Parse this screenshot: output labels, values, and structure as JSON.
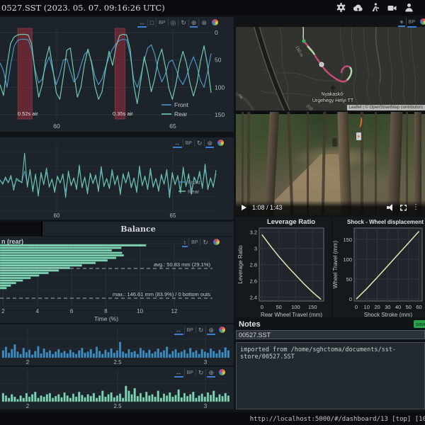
{
  "titlebar": {
    "title": "0527.SST (2023. 05. 07. 09:16:26 UTC)",
    "icons": [
      "settings",
      "cloud-upload",
      "rider-setup",
      "video-camera",
      "user"
    ]
  },
  "statusbar": {
    "url": "http://localhost:5000/#/dashboard/13 [top] [10"
  },
  "tabs": [
    {
      "label": "",
      "active": false
    },
    {
      "label": "Balance",
      "active": true
    }
  ],
  "toolbars": {
    "travel": {
      "tools": [
        "x-pan",
        "box-zoom",
        "bp",
        "wheel-zoom",
        "reset",
        "hover",
        "save",
        "logo"
      ],
      "active": [
        "x-pan",
        "hover"
      ]
    },
    "velocity": {
      "tools": [
        "x-pan",
        "bp",
        "reset",
        "hover",
        "logo"
      ],
      "active": [
        "x-pan",
        "hover"
      ]
    },
    "hist": {
      "tools": [
        "y-pan",
        "bp",
        "reset",
        "logo"
      ],
      "active": [
        "y-pan"
      ]
    },
    "vhist_front": {
      "tools": [
        "x-pan",
        "bp",
        "reset",
        "hover",
        "logo"
      ],
      "active": [
        "x-pan",
        "hover"
      ]
    },
    "vhist_rear": {
      "tools": [
        "x-pan",
        "bp",
        "reset",
        "hover",
        "logo"
      ],
      "active": [
        "x-pan",
        "hover"
      ]
    },
    "map": {
      "tools": [
        "pan",
        "bp",
        "logo"
      ],
      "active": [
        "pan",
        "bp"
      ]
    }
  },
  "charts": {
    "travel": {
      "type": "line",
      "y_ticks": [
        0,
        50,
        100,
        150
      ],
      "x_ticks": [
        60,
        65
      ],
      "legend": [
        "Front",
        "Rear"
      ],
      "air_bands": [
        {
          "label": "0.52s air",
          "from": 0.085,
          "to": 0.152
        },
        {
          "label": "0.35s air",
          "from": 0.545,
          "to": 0.592
        }
      ],
      "series": [
        {
          "name": "Front",
          "color": "#4d93c7",
          "values": [
            55,
            70,
            100,
            60,
            25,
            14,
            12,
            12,
            13,
            30,
            68,
            92,
            85,
            60,
            44,
            70,
            95,
            76,
            50,
            48,
            70,
            90,
            82,
            60,
            40,
            33,
            52,
            80,
            95,
            85,
            64,
            44,
            30,
            20,
            14,
            12,
            13,
            40,
            85,
            100,
            80,
            50,
            28,
            22,
            40,
            70,
            90,
            76,
            54,
            50,
            66,
            85,
            95,
            80,
            60,
            44,
            62,
            88,
            100,
            72,
            38
          ]
        },
        {
          "name": "Rear",
          "color": "#6fcbaa",
          "values": [
            95,
            115,
            60,
            20,
            8,
            4,
            3,
            3,
            4,
            20,
            75,
            118,
            95,
            50,
            25,
            65,
            110,
            122,
            80,
            32,
            28,
            75,
            118,
            100,
            58,
            30,
            55,
            98,
            122,
            108,
            68,
            34,
            60,
            25,
            5,
            3,
            4,
            30,
            95,
            130,
            88,
            44,
            72,
            108,
            84,
            48,
            30,
            62,
            102,
            122,
            94,
            58,
            34,
            56,
            92,
            116,
            92,
            52,
            24,
            60,
            110
          ]
        }
      ]
    },
    "velocity": {
      "type": "line",
      "x_ticks": [
        60,
        65
      ],
      "legend": [
        "Front",
        "Rear"
      ],
      "series": [
        {
          "name": "Front",
          "color": "#4d93c7",
          "values": [
            2,
            -5,
            8,
            -3,
            12,
            -18,
            4,
            0,
            -2,
            35,
            -10,
            35,
            -25,
            18,
            -40,
            22,
            -8,
            30,
            -15,
            5,
            -28,
            12,
            -4,
            18,
            -35,
            25,
            -10,
            8,
            -20,
            40,
            -15,
            10,
            -30,
            20,
            -5,
            15,
            -25,
            35,
            -12,
            6,
            -18,
            28,
            -8,
            14,
            -32,
            18,
            -4,
            22,
            -15,
            8,
            -26,
            36,
            -10,
            12,
            -20,
            30,
            -14,
            6,
            -24,
            16,
            -6,
            28,
            -38,
            20,
            -8,
            14,
            -28,
            34,
            -12,
            18,
            -30,
            10,
            -4,
            24,
            -16,
            40,
            -20,
            8,
            -14,
            26
          ]
        },
        {
          "name": "Rear",
          "color": "#6fcbaa",
          "values": [
            5,
            -10,
            15,
            -5,
            20,
            -30,
            10,
            3,
            -5,
            95,
            -20,
            40,
            -35,
            25,
            -50,
            30,
            -12,
            45,
            -20,
            8,
            -38,
            18,
            -6,
            25,
            -55,
            35,
            -15,
            12,
            -28,
            55,
            -22,
            15,
            -42,
            28,
            -8,
            22,
            -35,
            50,
            -18,
            10,
            -25,
            40,
            -12,
            20,
            -45,
            26,
            -6,
            32,
            -22,
            12,
            -38,
            52,
            -15,
            18,
            -28,
            44,
            -20,
            10,
            -34,
            24,
            -10,
            40,
            -55,
            30,
            -12,
            20,
            -40,
            48,
            -18,
            26,
            -44,
            15,
            -6,
            34,
            -24,
            58,
            -28,
            12,
            -20,
            38
          ]
        }
      ]
    },
    "travel_hist_rear": {
      "type": "bar-horizontal",
      "title_fragment": "n (rear)",
      "x_ticks": [
        2,
        4,
        6,
        8,
        10,
        12
      ],
      "xlabel": "Time (%)",
      "avg_label": "avg.: 50.83 mm (29.1%)",
      "max_label": "max.: 146.61 mm (83.9%) / 0 bottom outs",
      "bar_color": "#82d4b6",
      "values": [
        10.35,
        8.9,
        8.35,
        8.95,
        9.05,
        8.6,
        8.1,
        7.4,
        6.6,
        5.9,
        5.25,
        4.65,
        4.1,
        3.6,
        3.15,
        2.75,
        2.45,
        2.2
      ]
    },
    "velocity_hist_front": {
      "type": "bar",
      "x_ticks": [
        "2",
        "2.5",
        "3"
      ],
      "bar_color": "#3e8ec2",
      "bar_stroke": "#2f6f9a",
      "values": [
        12,
        18,
        8,
        14,
        22,
        10,
        6,
        16,
        9,
        13,
        5,
        11,
        19,
        7,
        15,
        9,
        12,
        6,
        10,
        14,
        8,
        11,
        7,
        13,
        9,
        6,
        12,
        16,
        8,
        10,
        14,
        7,
        18,
        11,
        6,
        13,
        9,
        15,
        8,
        12,
        26,
        10,
        7,
        14,
        9,
        11,
        6,
        16,
        12,
        8,
        13,
        7,
        10,
        15,
        9,
        12,
        18,
        6,
        11,
        14,
        8,
        10,
        13,
        7,
        16,
        9,
        12,
        6,
        14,
        10,
        8,
        15,
        11,
        7,
        13,
        9,
        17,
        12
      ]
    },
    "velocity_hist_rear": {
      "type": "bar",
      "x_ticks": [
        "2",
        "2.5",
        "3"
      ],
      "bar_color": "#82d4b6",
      "bar_stroke": "#54a184",
      "values": [
        14,
        10,
        6,
        12,
        8,
        4,
        10,
        6,
        14,
        8,
        12,
        16,
        6,
        10,
        8,
        12,
        14,
        6,
        9,
        12,
        7,
        15,
        10,
        6,
        13,
        8,
        16,
        11,
        7,
        12,
        9,
        14,
        6,
        10,
        18,
        8,
        12,
        15,
        7,
        10,
        13,
        6,
        26,
        18,
        12,
        22,
        9,
        14,
        7,
        16,
        10,
        12,
        8,
        18,
        6,
        13,
        10,
        15,
        8,
        11,
        20,
        7,
        14,
        9,
        12,
        16,
        6,
        10,
        13,
        8,
        15,
        11,
        18,
        7,
        12,
        9,
        14,
        10
      ]
    },
    "leverage": {
      "type": "line",
      "title": "Leverage Ratio",
      "xlabel": "Rear Wheel Travel (mm)",
      "ylabel": "Leverage Ratio",
      "x_ticks": [
        0,
        50,
        100,
        150
      ],
      "y_ticks": [
        3.2,
        3,
        2.8,
        2.6,
        2.4
      ],
      "line_color": "#e9e4b2",
      "points": [
        [
          0,
          3.17
        ],
        [
          25,
          3.03
        ],
        [
          50,
          2.9
        ],
        [
          75,
          2.78
        ],
        [
          100,
          2.67
        ],
        [
          125,
          2.56
        ],
        [
          150,
          2.46
        ],
        [
          175,
          2.37
        ]
      ]
    },
    "shock_wheel": {
      "type": "line",
      "title": "Shock - Wheel displacement",
      "xlabel": "Shock Stroke (mm)",
      "ylabel": "Wheel Travel (mm)",
      "x_ticks": [
        0,
        10,
        20,
        30,
        40,
        50,
        60
      ],
      "y_ticks": [
        150,
        100,
        50,
        0
      ],
      "line_color": "#e9e4b2",
      "points": [
        [
          0,
          0
        ],
        [
          10,
          26
        ],
        [
          20,
          54
        ],
        [
          30,
          83
        ],
        [
          40,
          112
        ],
        [
          50,
          141
        ],
        [
          60,
          170
        ]
      ]
    }
  },
  "map": {
    "poi_line1": "Nyakaskő-",
    "poi_line2": "Ürgehegy Helyi TT",
    "contour_label": "150 m",
    "contour_label2": "200 m",
    "street_fragment": "ca",
    "attribution": "Leaflet | © OpenStreetMap contributors"
  },
  "video": {
    "time": "1:08 / 1:43"
  },
  "notes": {
    "header": "Notes",
    "save_label": "save",
    "name_value": "00527.SST",
    "body": "imported from /home/sghctoma/documents/sst-store/00527.SST"
  }
}
